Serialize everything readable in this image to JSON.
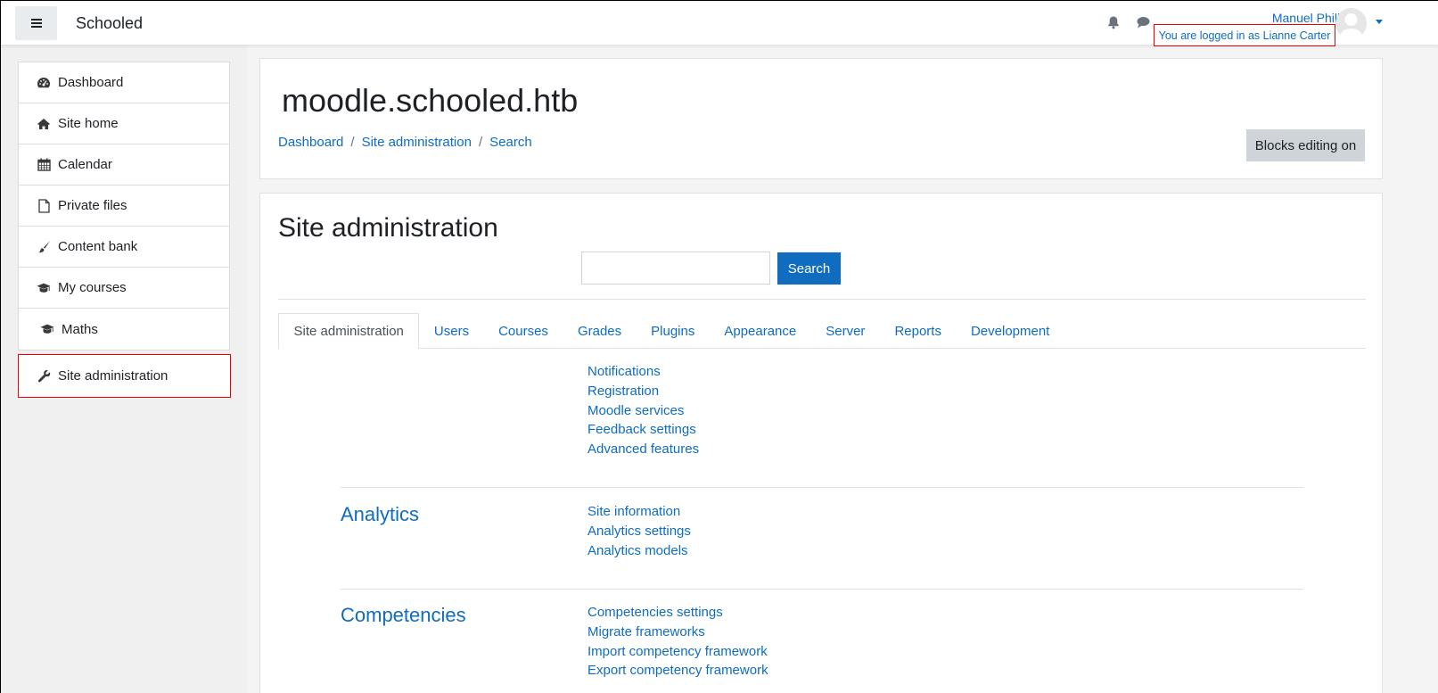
{
  "navbar": {
    "brand": "Schooled",
    "user_name": "Manuel Phillips",
    "logged_in_as": "You are logged in as Lianne Carter"
  },
  "drawer": {
    "items": [
      {
        "label": "Dashboard",
        "icon": "dashboard-icon"
      },
      {
        "label": "Site home",
        "icon": "home-icon"
      },
      {
        "label": "Calendar",
        "icon": "calendar-icon"
      },
      {
        "label": "Private files",
        "icon": "file-icon"
      },
      {
        "label": "Content bank",
        "icon": "brush-icon"
      },
      {
        "label": "My courses",
        "icon": "graduation-cap-icon"
      },
      {
        "label": "Maths",
        "icon": "graduation-cap-icon"
      }
    ],
    "admin_label": "Site administration"
  },
  "header": {
    "site_title": "moodle.schooled.htb",
    "breadcrumb": [
      "Dashboard",
      "Site administration",
      "Search"
    ],
    "blocks_editing": "Blocks editing on"
  },
  "content": {
    "heading": "Site administration",
    "search_button": "Search",
    "search_value": "",
    "tabs": [
      "Site administration",
      "Users",
      "Courses",
      "Grades",
      "Plugins",
      "Appearance",
      "Server",
      "Reports",
      "Development"
    ],
    "general_links": [
      "Notifications",
      "Registration",
      "Moodle services",
      "Feedback settings",
      "Advanced features"
    ],
    "sections": [
      {
        "title": "Analytics",
        "links": [
          "Site information",
          "Analytics settings",
          "Analytics models"
        ]
      },
      {
        "title": "Competencies",
        "links": [
          "Competencies settings",
          "Migrate frameworks",
          "Import competency framework",
          "Export competency framework"
        ]
      }
    ]
  },
  "colors": {
    "link": "#0f6cbf",
    "highlight_border": "#ee0000",
    "drawer_bg": "#f0f0f0"
  }
}
